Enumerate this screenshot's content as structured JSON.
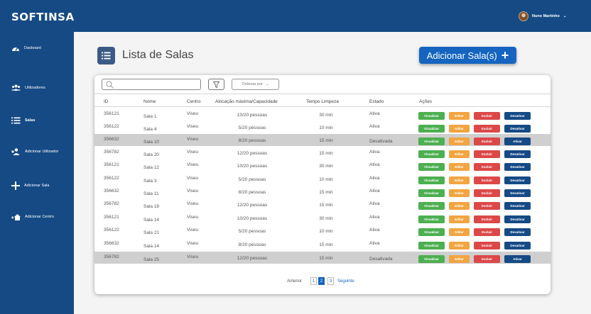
{
  "header": {
    "logo": "SOFTINSA",
    "user_name": "Nuno Martinho"
  },
  "sidebar": {
    "items": [
      {
        "label": "Dasboard",
        "icon": "dashboard-icon"
      },
      {
        "label": "Utilizadores",
        "icon": "users-icon"
      },
      {
        "label": "Salas",
        "icon": "list-icon"
      },
      {
        "label": "Adicionar Utilizador",
        "icon": "add-user-icon"
      },
      {
        "label": "Adicionar Sala",
        "icon": "plus-icon"
      },
      {
        "label": "Adicionar Centro",
        "icon": "add-home-icon"
      }
    ]
  },
  "page": {
    "title": "Lista de Salas",
    "add_button": "Adicionar Sala(s)"
  },
  "toolbar": {
    "search_placeholder": "",
    "sort_label": "Ordenar por"
  },
  "table": {
    "headers": [
      "ID",
      "Nome",
      "Centro",
      "Alocação máxima/Capacidade",
      "Tempo Limpeza",
      "Estado",
      "Ações"
    ],
    "rows": [
      {
        "id": "356121",
        "nome": "Sala 1",
        "centro": "Viseu",
        "alocacao": "10/20 pessoas",
        "tempo": "30 min",
        "estado": "Ativa",
        "toggle": "Desativar"
      },
      {
        "id": "356122",
        "nome": "Sala 4",
        "centro": "Viseu",
        "alocacao": "5/20 pessoas",
        "tempo": "10 min",
        "estado": "Ativa",
        "toggle": "Desativar"
      },
      {
        "id": "356632",
        "nome": "Sala 10",
        "centro": "Viseu",
        "alocacao": "8/20 pessoas",
        "tempo": "15 min",
        "estado": "Desativada",
        "toggle": "Ativar"
      },
      {
        "id": "356782",
        "nome": "Sala 20",
        "centro": "Viseu",
        "alocacao": "12/20 pessoas",
        "tempo": "15 min",
        "estado": "Ativa",
        "toggle": "Desativar"
      },
      {
        "id": "356121",
        "nome": "Sala 12",
        "centro": "Viseu",
        "alocacao": "10/20 pessoas",
        "tempo": "30 min",
        "estado": "Ativa",
        "toggle": "Desativar"
      },
      {
        "id": "356122",
        "nome": "Sala 3",
        "centro": "Viseu",
        "alocacao": "5/20 pessoas",
        "tempo": "10 min",
        "estado": "Ativa",
        "toggle": "Desativar"
      },
      {
        "id": "356632",
        "nome": "Sala 11",
        "centro": "Viseu",
        "alocacao": "8/20 pessoas",
        "tempo": "15 min",
        "estado": "Ativa",
        "toggle": "Desativar"
      },
      {
        "id": "356782",
        "nome": "Sala 19",
        "centro": "Viseu",
        "alocacao": "12/20 pessoas",
        "tempo": "15 min",
        "estado": "Ativa",
        "toggle": "Desativar"
      },
      {
        "id": "356121",
        "nome": "Sala 14",
        "centro": "Viseu",
        "alocacao": "10/20 pessoas",
        "tempo": "30 min",
        "estado": "Ativa",
        "toggle": "Desativar"
      },
      {
        "id": "356122",
        "nome": "Sala 21",
        "centro": "Viseu",
        "alocacao": "5/20 pessoas",
        "tempo": "10 min",
        "estado": "Ativa",
        "toggle": "Desativar"
      },
      {
        "id": "356632",
        "nome": "Sala 14",
        "centro": "Viseu",
        "alocacao": "8/20 pessoas",
        "tempo": "15 min",
        "estado": "Ativa",
        "toggle": "Desativar"
      },
      {
        "id": "356782",
        "nome": "Sala 25",
        "centro": "Viseu",
        "alocacao": "12/20 pessoas",
        "tempo": "15 min",
        "estado": "Desativada",
        "toggle": "Ativar"
      }
    ],
    "actions": {
      "view": "Visualizar",
      "edit": "Editar",
      "delete": "Excluir"
    }
  },
  "pagination": {
    "prev": "Anterior",
    "pages": [
      "1",
      "2",
      "3"
    ],
    "current": "2",
    "next": "Seguinte"
  },
  "colors": {
    "primary": "#154a85",
    "accent": "#1565c0",
    "view": "#4caf50",
    "edit": "#f2a541",
    "delete": "#dc4848",
    "disabled_row": "#cfcfcf"
  }
}
